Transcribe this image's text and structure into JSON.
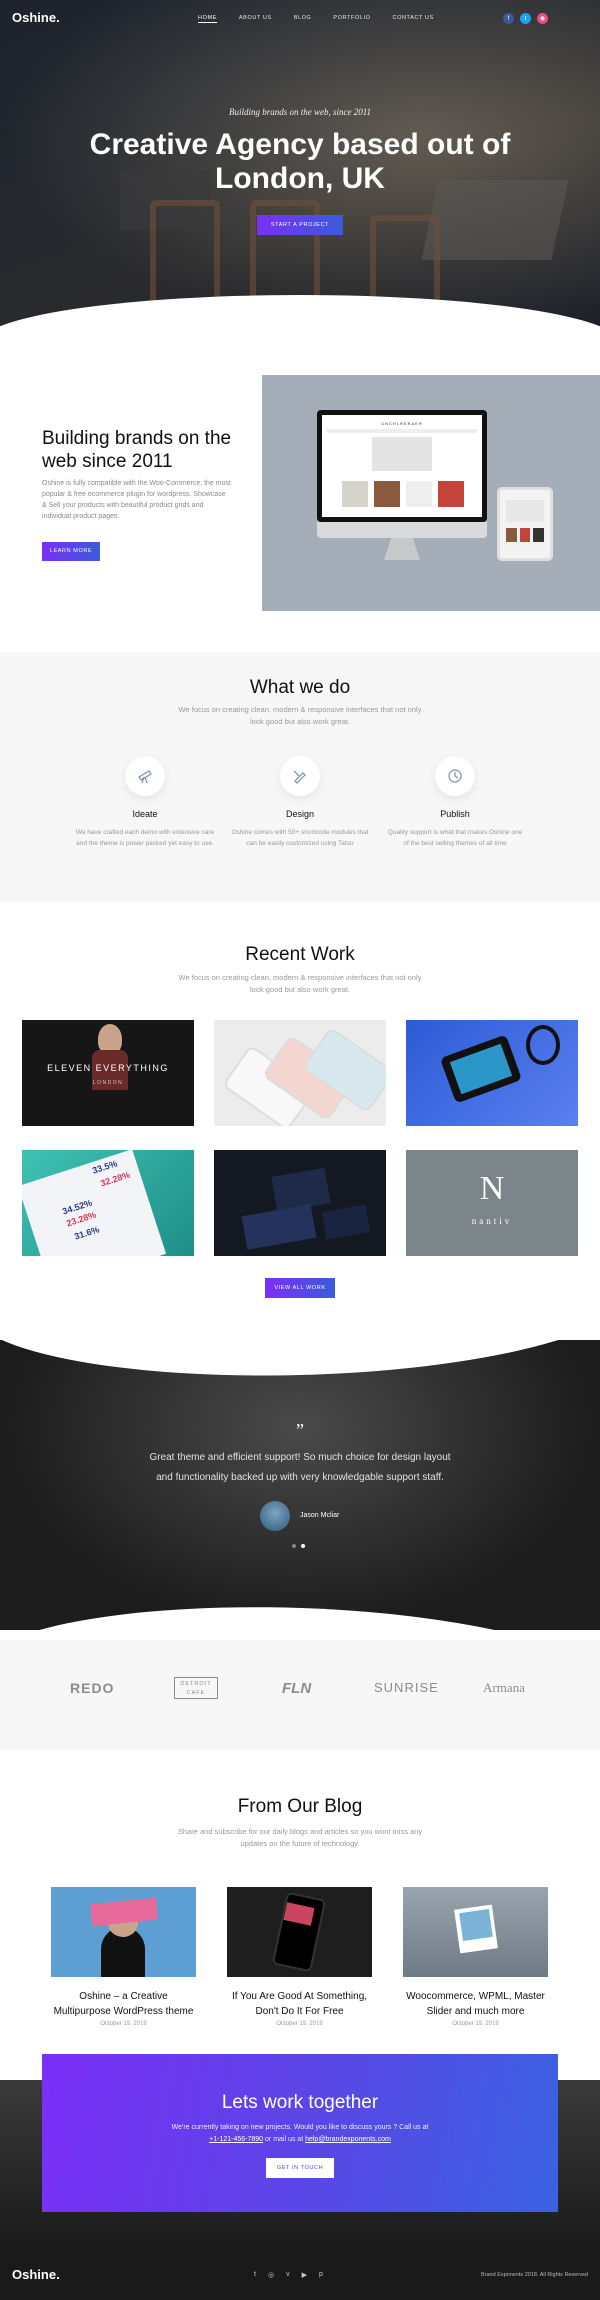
{
  "nav": {
    "logo": "Oshine.",
    "menu": [
      "HOME",
      "ABOUT US",
      "BLOG",
      "PORTFOLIO",
      "CONTACT US"
    ],
    "social": [
      {
        "label": "f",
        "icon": "facebook-icon",
        "color": "#3b5998"
      },
      {
        "label": "t",
        "icon": "twitter-icon",
        "color": "#1da1f2"
      },
      {
        "label": "◉",
        "icon": "dribbble-icon",
        "color": "#ea4c89"
      }
    ]
  },
  "hero": {
    "subtitle": "Building brands on the web, since 2011",
    "title": "Creative Agency based out of London, UK",
    "button": "START A PROJECT"
  },
  "about": {
    "title": "Building brands on the web since 2011",
    "text": "Oshine is fully compatible with the Woo-Commerce, the most popular & free ecommerce plugin for wordpress. Showcase & Sell your products with beautiful product grids and individual product pages.",
    "button": "LEARN MORE",
    "screen_brand": "UNCHLRERAER"
  },
  "services": {
    "title": "What we do",
    "description": "We focus on creating clean, modern & responsive interfaces that not only look good but also work great.",
    "items": [
      {
        "icon": "telescope-icon",
        "name": "Ideate",
        "text": "We have crafted each demo with extensive care and the theme is power packed yet easy to use."
      },
      {
        "icon": "pencil-ruler-icon",
        "name": "Design",
        "text": "Oshine comes with 50+ shortcode modules that can be easily customized using Tatsu"
      },
      {
        "icon": "clock-icon",
        "name": "Publish",
        "text": "Quality support is what that makes Oshine one of the best selling themes of all time"
      }
    ]
  },
  "work": {
    "title": "Recent Work",
    "description": "We focus on creating clean, modern & responsive interfaces that not only look good but also work great.",
    "tile1_title": "ELEVEN EVERYTHING",
    "tile1_sub": "LONDON",
    "tile4_numbers": [
      "33.5%",
      "32.28%",
      "34.52%",
      "23.28%",
      "31.6%"
    ],
    "tile6_letter": "N",
    "tile6_word": "nantiv",
    "button": "VIEW ALL WORK"
  },
  "testimonial": {
    "quote": "Great theme and efficient support! So much choice for design layout and functionality backed up with very knowledgable support staff.",
    "author": "Jason Mcliar"
  },
  "clients": [
    "REDO",
    "DETROIT CAFE",
    "FLN",
    "SUNRISE",
    "Armana"
  ],
  "blog": {
    "title": "From Our Blog",
    "description": "Share and subscribe for our daily blogs and articles so you wont miss any updates on the future of technology.",
    "posts": [
      {
        "title": "Oshine – a Creative Multipurpose WordPress theme",
        "date": "October 19, 2019"
      },
      {
        "title": "If You Are Good At Something, Don't Do It For Free",
        "date": "October 19, 2019"
      },
      {
        "title": "Woocommerce, WPML, Master Slider and much more",
        "date": "October 19, 2019"
      }
    ]
  },
  "cta": {
    "title": "Lets work together",
    "line1": "We're currently taking on new projects. Would you like to discuss yours ? Call us at",
    "phone": "+1-121-456-7890",
    "or_mail": " or mail us at ",
    "email": "help@brandexponents.com",
    "button": "GET IN TOUCH"
  },
  "footer": {
    "logo": "Oshine.",
    "social": [
      "t",
      "◎",
      "v",
      "▶",
      "p"
    ],
    "copyright": "Brand Exponents 2018. All Rights Reserved"
  },
  "colors": {
    "accent_start": "#7b2ff7",
    "accent_end": "#3b5bdb",
    "dark": "#1a1a1a"
  }
}
